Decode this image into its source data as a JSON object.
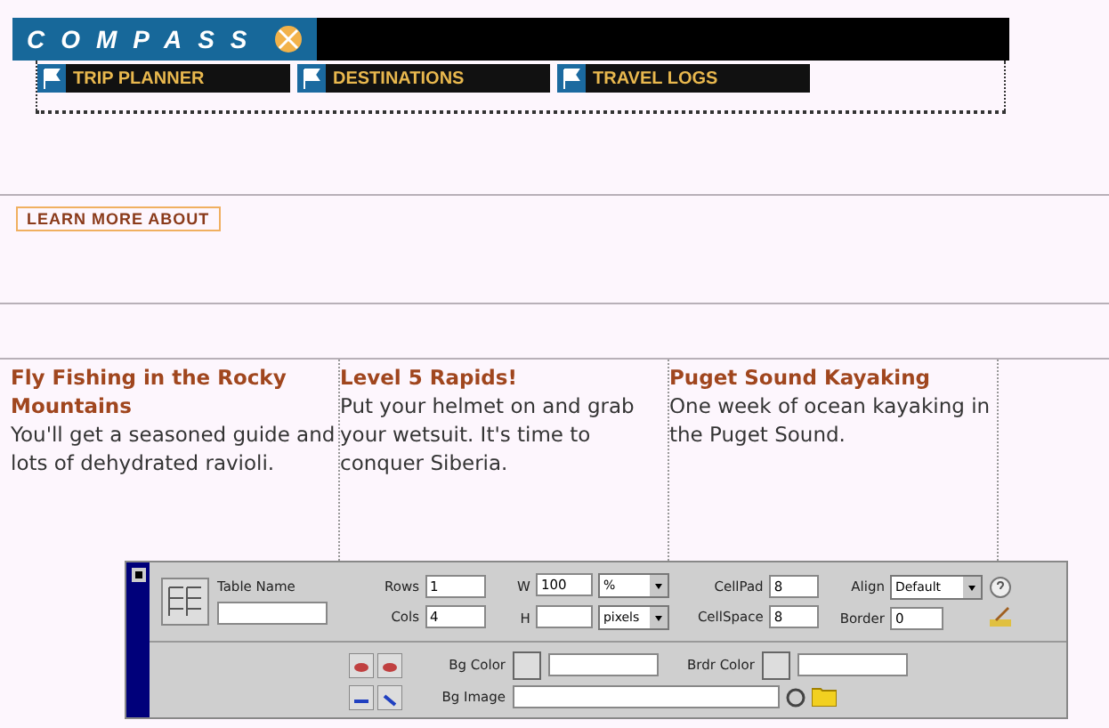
{
  "logo": {
    "text": "COMPASS"
  },
  "nav": [
    {
      "label": "TRIP PLANNER"
    },
    {
      "label": "DESTINATIONS"
    },
    {
      "label": "TRAVEL LOGS"
    }
  ],
  "section_heading": "LEARN MORE ABOUT",
  "articles": [
    {
      "title": "Fly Fishing in the Rocky Mountains",
      "body": "You'll get a seasoned guide and lots of dehydrated ravioli."
    },
    {
      "title": "Level 5 Rapids!",
      "body": "Put your helmet on and grab your wetsuit. It's time to conquer Siberia."
    },
    {
      "title": "Puget Sound Kayaking",
      "body": "One week of ocean kayaking in the Puget Sound."
    }
  ],
  "inspector": {
    "table_name_label": "Table Name",
    "rows": {
      "label": "Rows",
      "value": "1"
    },
    "cols": {
      "label": "Cols",
      "value": "4"
    },
    "width": {
      "label": "W",
      "value": "100",
      "unit": "%"
    },
    "height": {
      "label": "H",
      "unit": "pixels"
    },
    "cell_pad": {
      "label": "CellPad",
      "value": "8"
    },
    "cell_space": {
      "label": "CellSpace",
      "value": "8"
    },
    "align": {
      "label": "Align",
      "value": "Default"
    },
    "border": {
      "label": "Border",
      "value": "0"
    },
    "bg_color": {
      "label": "Bg Color"
    },
    "brdr_color": {
      "label": "Brdr Color"
    },
    "bg_image": {
      "label": "Bg Image"
    }
  }
}
